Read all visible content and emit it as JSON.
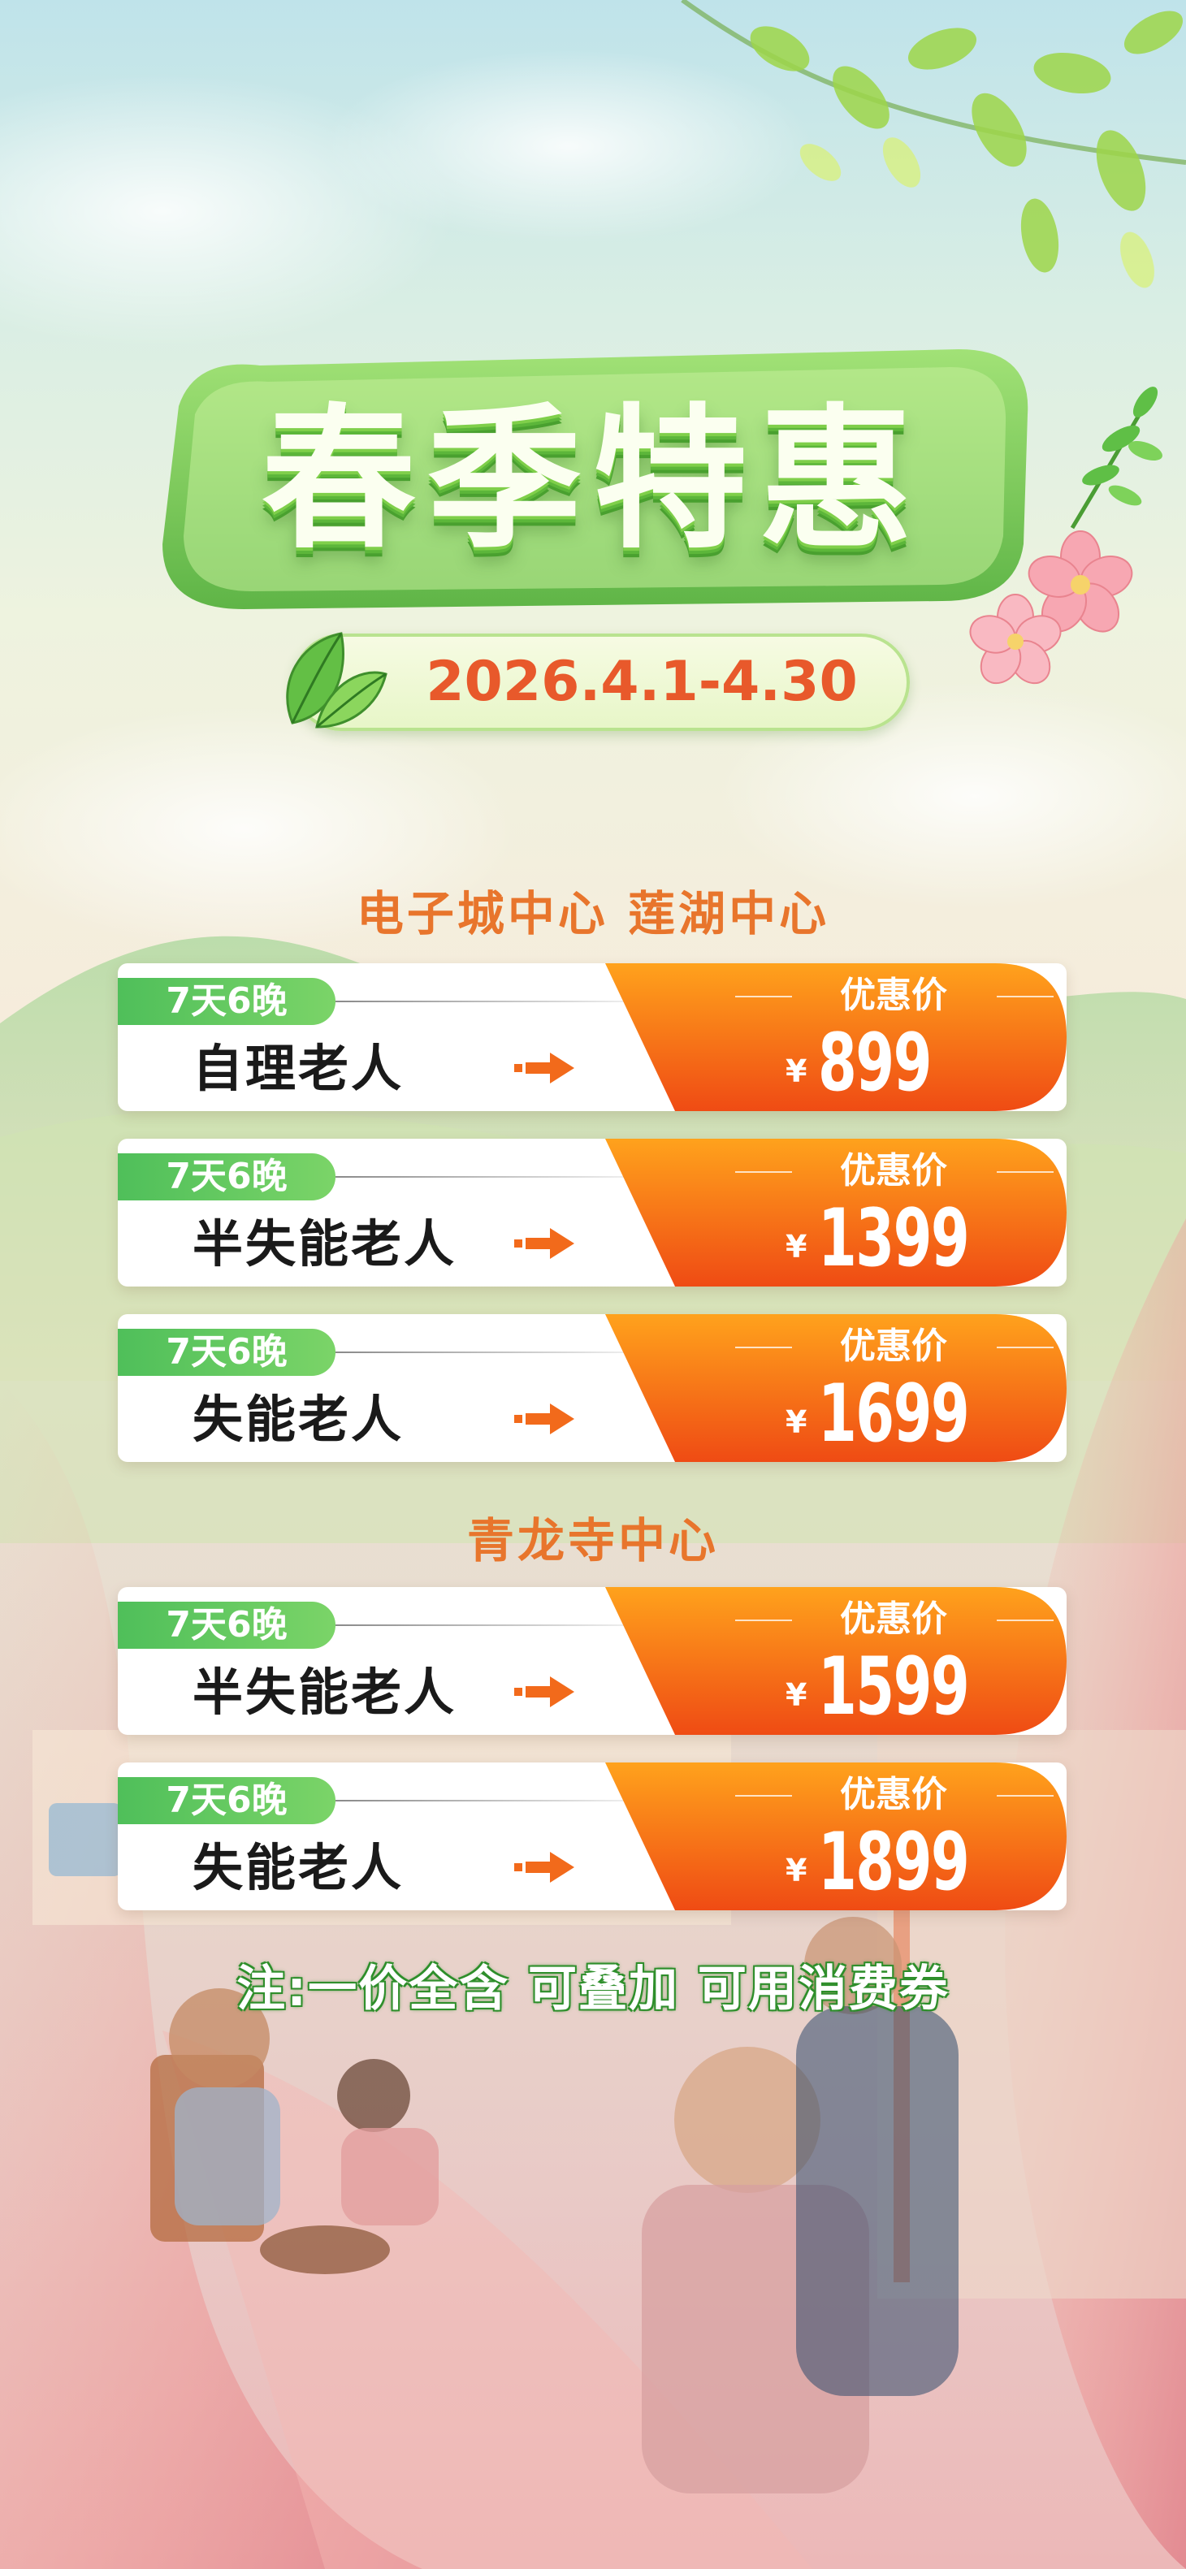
{
  "promo": {
    "title": "春季特惠",
    "date_range": "2026.4.1-4.30"
  },
  "sections": [
    {
      "title": "电子城中心  莲湖中心",
      "cards": [
        {
          "tag": "7天6晚",
          "name": "自理老人",
          "price_label": "优惠价",
          "currency": "¥",
          "price": "899"
        },
        {
          "tag": "7天6晚",
          "name": "半失能老人",
          "price_label": "优惠价",
          "currency": "¥",
          "price": "1399"
        },
        {
          "tag": "7天6晚",
          "name": "失能老人",
          "price_label": "优惠价",
          "currency": "¥",
          "price": "1699"
        }
      ]
    },
    {
      "title": "青龙寺中心",
      "cards": [
        {
          "tag": "7天6晚",
          "name": "半失能老人",
          "price_label": "优惠价",
          "currency": "¥",
          "price": "1599"
        },
        {
          "tag": "7天6晚",
          "name": "失能老人",
          "price_label": "优惠价",
          "currency": "¥",
          "price": "1899"
        }
      ]
    }
  ],
  "note": "注:一价全含 可叠加 可用消费券",
  "colors": {
    "accent_orange": "#f26a1b",
    "tag_green": "#4fbf5a",
    "title_orange": "#e8752c",
    "date_red": "#e8592b"
  }
}
